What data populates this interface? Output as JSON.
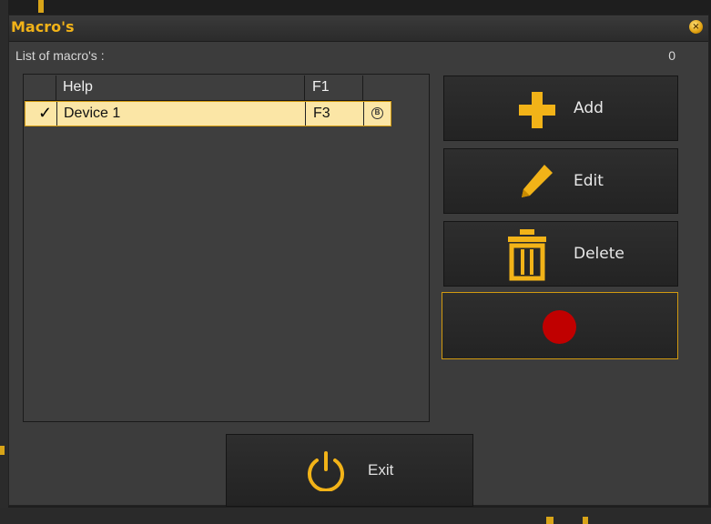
{
  "window": {
    "title": "Macro's",
    "close_glyph": "×"
  },
  "list": {
    "header_label": "List of macro's :",
    "count": "0",
    "rows": [
      {
        "name": "Help",
        "key": "F1",
        "checked": false
      },
      {
        "name": "Device 1",
        "key": "F3",
        "checked": true,
        "check_glyph": "✓",
        "badge_glyph": "B"
      }
    ]
  },
  "buttons": {
    "add": "Add",
    "edit": "Edit",
    "delete": "Delete",
    "exit": "Exit"
  },
  "icons": {
    "add": "plus-icon",
    "edit": "pencil-icon",
    "delete": "trash-icon",
    "record": "record-icon",
    "exit": "power-icon"
  },
  "colors": {
    "accent": "#f2b318",
    "selection": "#fbe6a6",
    "record": "#c00000",
    "window_bg": "#3c3c3c"
  }
}
